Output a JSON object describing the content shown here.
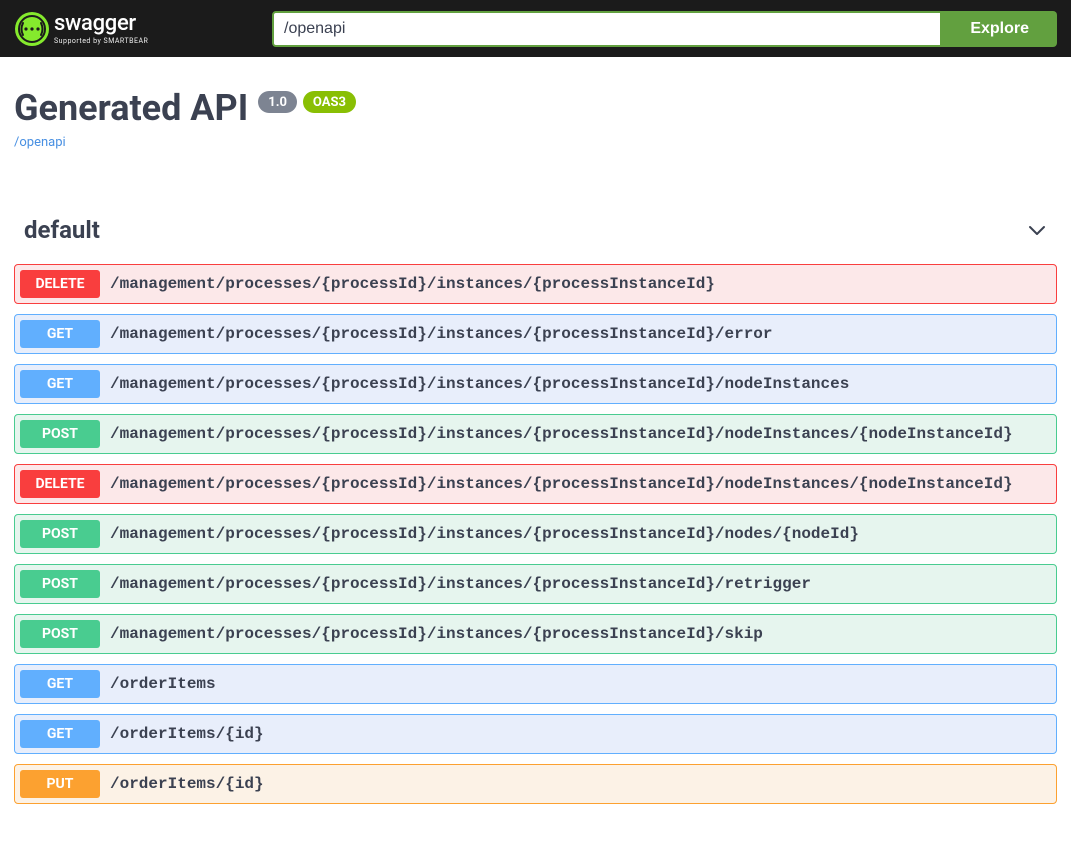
{
  "topbar": {
    "url_value": "/openapi",
    "explore_label": "Explore",
    "logo_main": "swagger",
    "logo_sub": "Supported by SMARTBEAR"
  },
  "info": {
    "title": "Generated API",
    "version": "1.0",
    "oas_badge": "OAS3",
    "spec_link": "/openapi"
  },
  "tag": {
    "name": "default"
  },
  "operations": [
    {
      "method": "DELETE",
      "cls": "m-delete",
      "path": "/management/processes/{processId}/instances/{processInstanceId}"
    },
    {
      "method": "GET",
      "cls": "m-get",
      "path": "/management/processes/{processId}/instances/{processInstanceId}/error"
    },
    {
      "method": "GET",
      "cls": "m-get",
      "path": "/management/processes/{processId}/instances/{processInstanceId}/nodeInstances"
    },
    {
      "method": "POST",
      "cls": "m-post",
      "path": "/management/processes/{processId}/instances/{processInstanceId}/nodeInstances/{nodeInstanceId}"
    },
    {
      "method": "DELETE",
      "cls": "m-delete",
      "path": "/management/processes/{processId}/instances/{processInstanceId}/nodeInstances/{nodeInstanceId}"
    },
    {
      "method": "POST",
      "cls": "m-post",
      "path": "/management/processes/{processId}/instances/{processInstanceId}/nodes/{nodeId}"
    },
    {
      "method": "POST",
      "cls": "m-post",
      "path": "/management/processes/{processId}/instances/{processInstanceId}/retrigger"
    },
    {
      "method": "POST",
      "cls": "m-post",
      "path": "/management/processes/{processId}/instances/{processInstanceId}/skip"
    },
    {
      "method": "GET",
      "cls": "m-get",
      "path": "/orderItems"
    },
    {
      "method": "GET",
      "cls": "m-get",
      "path": "/orderItems/{id}"
    },
    {
      "method": "PUT",
      "cls": "m-put",
      "path": "/orderItems/{id}"
    }
  ]
}
